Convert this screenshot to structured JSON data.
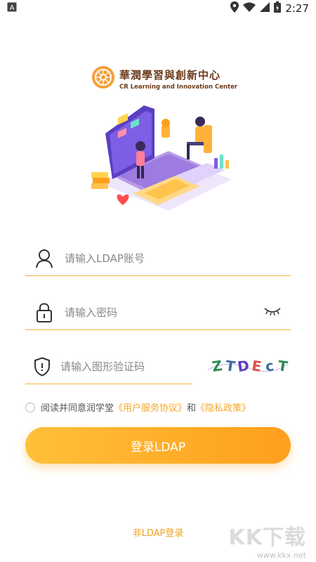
{
  "status_bar": {
    "time": "2:27",
    "notification_icon": "a-icon",
    "icons": [
      "location-icon",
      "wifi-icon",
      "signal-icon",
      "battery-icon"
    ]
  },
  "logo": {
    "name_cn": "華潤學習與創新中心",
    "name_en": "CR Learning and Innovation Center"
  },
  "form": {
    "account_placeholder": "请输入LDAP账号",
    "password_placeholder": "请输入密码",
    "captcha_placeholder": "请输入图形验证码",
    "captcha_text": "ZTDEcT"
  },
  "agreement": {
    "prefix": "阅读并同意润学堂",
    "terms": "《用户服务协议》",
    "and": "和",
    "privacy": "《隐私政策》"
  },
  "login_button": "登录LDAP",
  "non_ldap_link": "非LDAP登录",
  "watermark": {
    "main": "KK下载",
    "sub": "www.kkx.net"
  },
  "colors": {
    "accent": "#f5a623",
    "button_start": "#ffc03a",
    "button_end": "#ff9f1c",
    "underline": "#f5b13f"
  }
}
